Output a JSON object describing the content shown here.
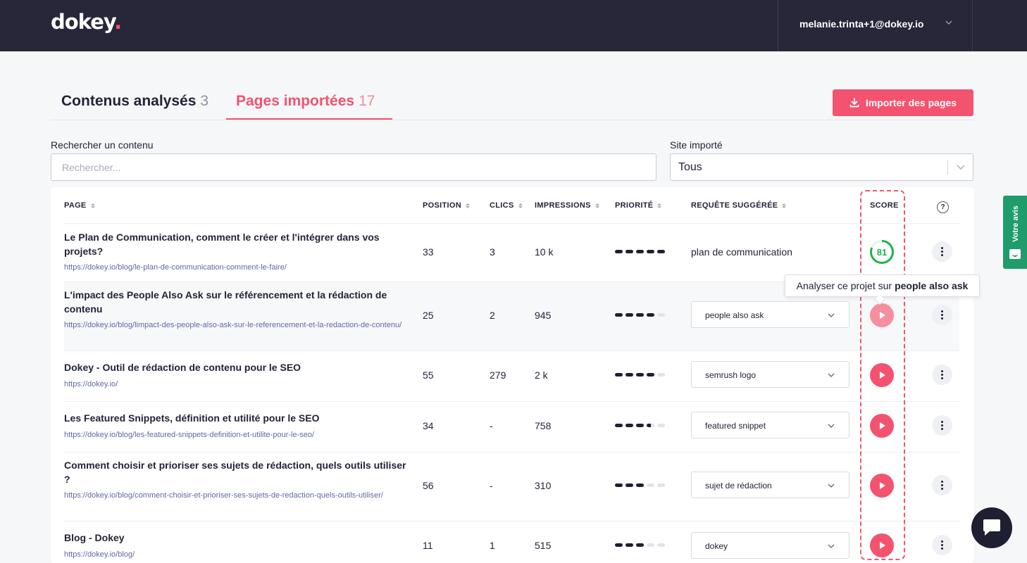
{
  "header": {
    "logo_text": "dokey",
    "logo_dot": ".",
    "user_email": "melanie.trinta+1@dokey.io"
  },
  "tabs": [
    {
      "label": "Contenus analysés",
      "count": "3"
    },
    {
      "label": "Pages importées",
      "count": "17"
    }
  ],
  "import_button": {
    "label": "Importer des pages"
  },
  "search": {
    "label": "Rechercher un contenu",
    "placeholder": "Rechercher..."
  },
  "site_filter": {
    "label": "Site importé",
    "value": "Tous"
  },
  "table": {
    "columns": {
      "page": "PAGE",
      "position": "POSITION",
      "clicks": "CLICS",
      "impressions": "IMPRESSIONS",
      "priority": "PRIORITÉ",
      "query": "REQUÊTE SUGGÉRÉE",
      "score": "SCORE",
      "help": "?"
    },
    "rows": [
      {
        "title": "Le Plan de Communication, comment le créer et l'intégrer dans vos projets?",
        "url": "https://dokey.io/blog/le-plan-de-communication-comment-le-faire/",
        "position": "33",
        "clicks": "3",
        "impressions": "10 k",
        "priority": 5,
        "query": "plan de communication",
        "score": "81"
      },
      {
        "title": "L'impact des People Also Ask sur le référencement et la rédaction de contenu",
        "url": "https://dokey.io/blog/limpact-des-people-also-ask-sur-le-referencement-et-la-redaction-de-contenu/",
        "position": "25",
        "clicks": "2",
        "impressions": "945",
        "priority": 4,
        "query": "people also ask"
      },
      {
        "title": "Dokey - Outil de rédaction de contenu pour le SEO",
        "url": "https://dokey.io/",
        "position": "55",
        "clicks": "279",
        "impressions": "2 k",
        "priority": 4,
        "query": "semrush logo"
      },
      {
        "title": "Les Featured Snippets, définition et utilité pour le SEO",
        "url": "https://dokey.io/blog/les-featured-snippets-definition-et-utilite-pour-le-seo/",
        "position": "34",
        "clicks": "-",
        "impressions": "758",
        "priority": 3.5,
        "query": "featured snippet"
      },
      {
        "title": "Comment choisir et prioriser ses sujets de rédaction, quels outils utiliser ?",
        "url": "https://dokey.io/blog/comment-choisir-et-prioriser-ses-sujets-de-redaction-quels-outils-utiliser/",
        "position": "56",
        "clicks": "-",
        "impressions": "310",
        "priority": 3,
        "query": "sujet de rédaction"
      },
      {
        "title": "Blog - Dokey",
        "url": "https://dokey.io/blog/",
        "position": "11",
        "clicks": "1",
        "impressions": "515",
        "priority": 3,
        "query": "dokey"
      }
    ]
  },
  "tooltip": {
    "prefix": "Analyser ce projet sur",
    "query": "people also ask"
  },
  "feedback_tab": {
    "label": "Votre avis"
  },
  "colors": {
    "brand": "#f3536f",
    "topbar": "#272739",
    "score_green": "#1fb24a",
    "feedback": "#1f9b6c"
  }
}
